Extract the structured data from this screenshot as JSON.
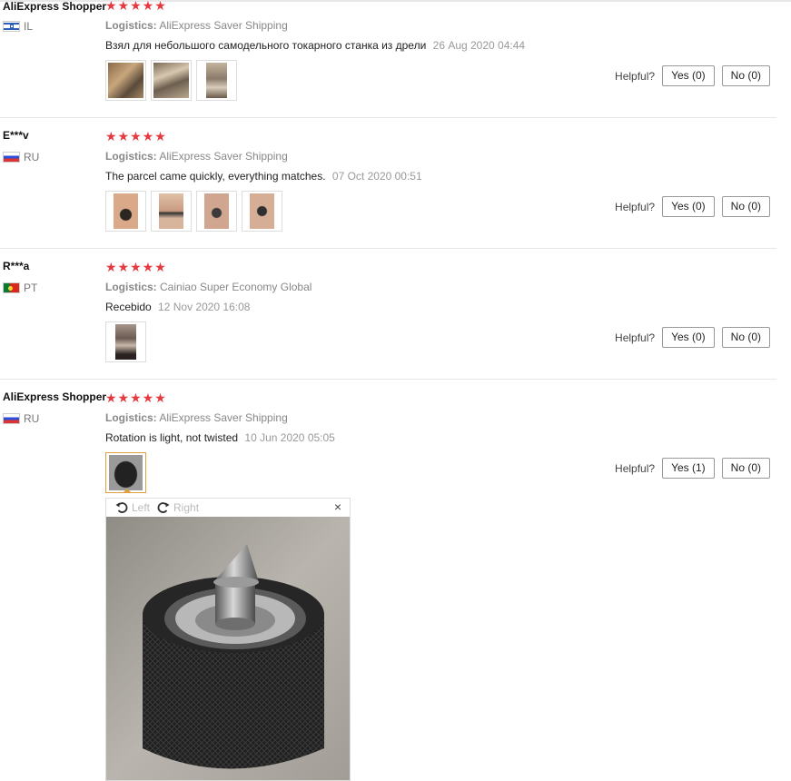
{
  "reviews": [
    {
      "user": "AliExpress Shopper",
      "country": "IL",
      "stars": "★★★★★",
      "logistics_label": "Logistics:",
      "logistics": "AliExpress Saver Shipping",
      "text": "Взял для небольшого самодельного токарного станка из дрели",
      "date": "26 Aug 2020 04:44",
      "helpful_label": "Helpful?",
      "yes": "Yes (0)",
      "no": "No (0)"
    },
    {
      "user": "E***v",
      "country": "RU",
      "stars": "★★★★★",
      "logistics_label": "Logistics:",
      "logistics": "AliExpress Saver Shipping",
      "text": "The parcel came quickly, everything matches.",
      "date": "07 Oct 2020 00:51",
      "helpful_label": "Helpful?",
      "yes": "Yes (0)",
      "no": "No (0)"
    },
    {
      "user": "R***a",
      "country": "PT",
      "stars": "★★★★★",
      "logistics_label": "Logistics:",
      "logistics": "Cainiao Super Economy Global",
      "text": "Recebido",
      "date": "12 Nov 2020 16:08",
      "helpful_label": "Helpful?",
      "yes": "Yes (0)",
      "no": "No (0)"
    },
    {
      "user": "AliExpress Shopper",
      "country": "RU",
      "stars": "★★★★★",
      "logistics_label": "Logistics:",
      "logistics": "AliExpress Saver Shipping",
      "text": "Rotation is light, not twisted",
      "date": "10 Jun 2020 05:05",
      "helpful_label": "Helpful?",
      "yes": "Yes (1)",
      "no": "No (0)"
    }
  ],
  "viewer": {
    "rotate_left": "Left",
    "rotate_right": "Right",
    "close": "×"
  },
  "colors": {
    "star": "#e6393f",
    "selected_border": "#e0a040"
  }
}
